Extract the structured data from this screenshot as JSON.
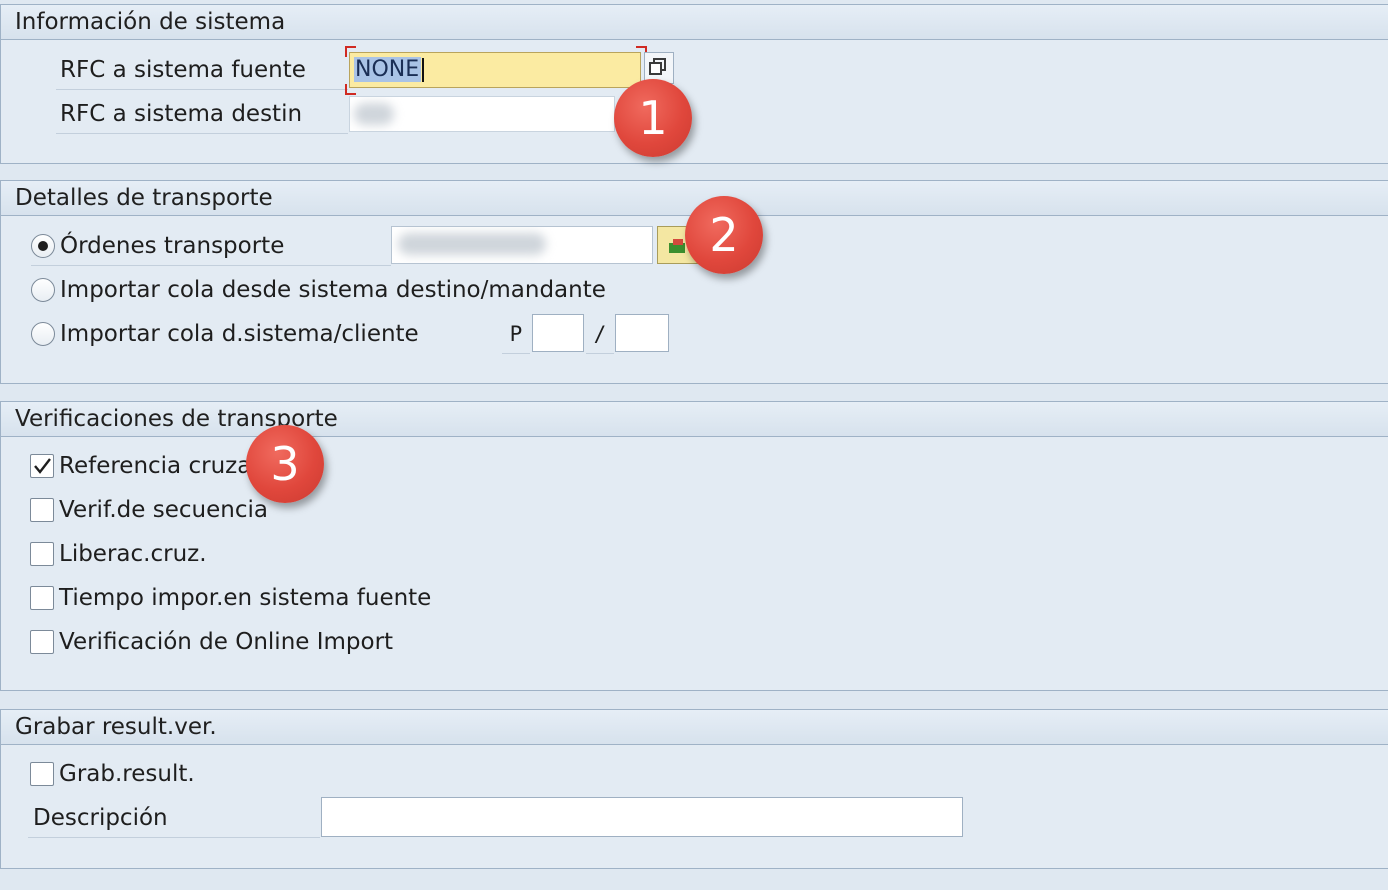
{
  "sections": {
    "system_info": {
      "title": "Información de sistema",
      "rfc_source_label": "RFC a sistema fuente",
      "rfc_source_value": "NONE",
      "rfc_dest_label": "RFC a sistema destin"
    },
    "transport_details": {
      "title": "Detalles de transporte",
      "option_orders": "Órdenes transporte",
      "option_import_queue_dest": "Importar cola desde sistema destino/mandante",
      "option_import_queue_client": "Importar cola d.sistema/cliente",
      "queue_prefix": "P",
      "queue_separator": "/"
    },
    "transport_checks": {
      "title": "Verificaciones de transporte",
      "items": [
        {
          "label": "Referencia cruzada",
          "checked": true
        },
        {
          "label": "Verif.de secuencia",
          "checked": false
        },
        {
          "label": "Liberac.cruz.",
          "checked": false
        },
        {
          "label": "Tiempo impor.en sistema fuente",
          "checked": false
        },
        {
          "label": "Verificación de Online Import",
          "checked": false
        }
      ]
    },
    "save_results": {
      "title": "Grabar result.ver.",
      "save_label": "Grab.result.",
      "description_label": "Descripción",
      "description_value": ""
    }
  },
  "badges": [
    "1",
    "2",
    "3"
  ],
  "colors": {
    "focus_field": "#fbeba2",
    "focus_corner": "#d02a22",
    "badge": "#e0473c"
  }
}
